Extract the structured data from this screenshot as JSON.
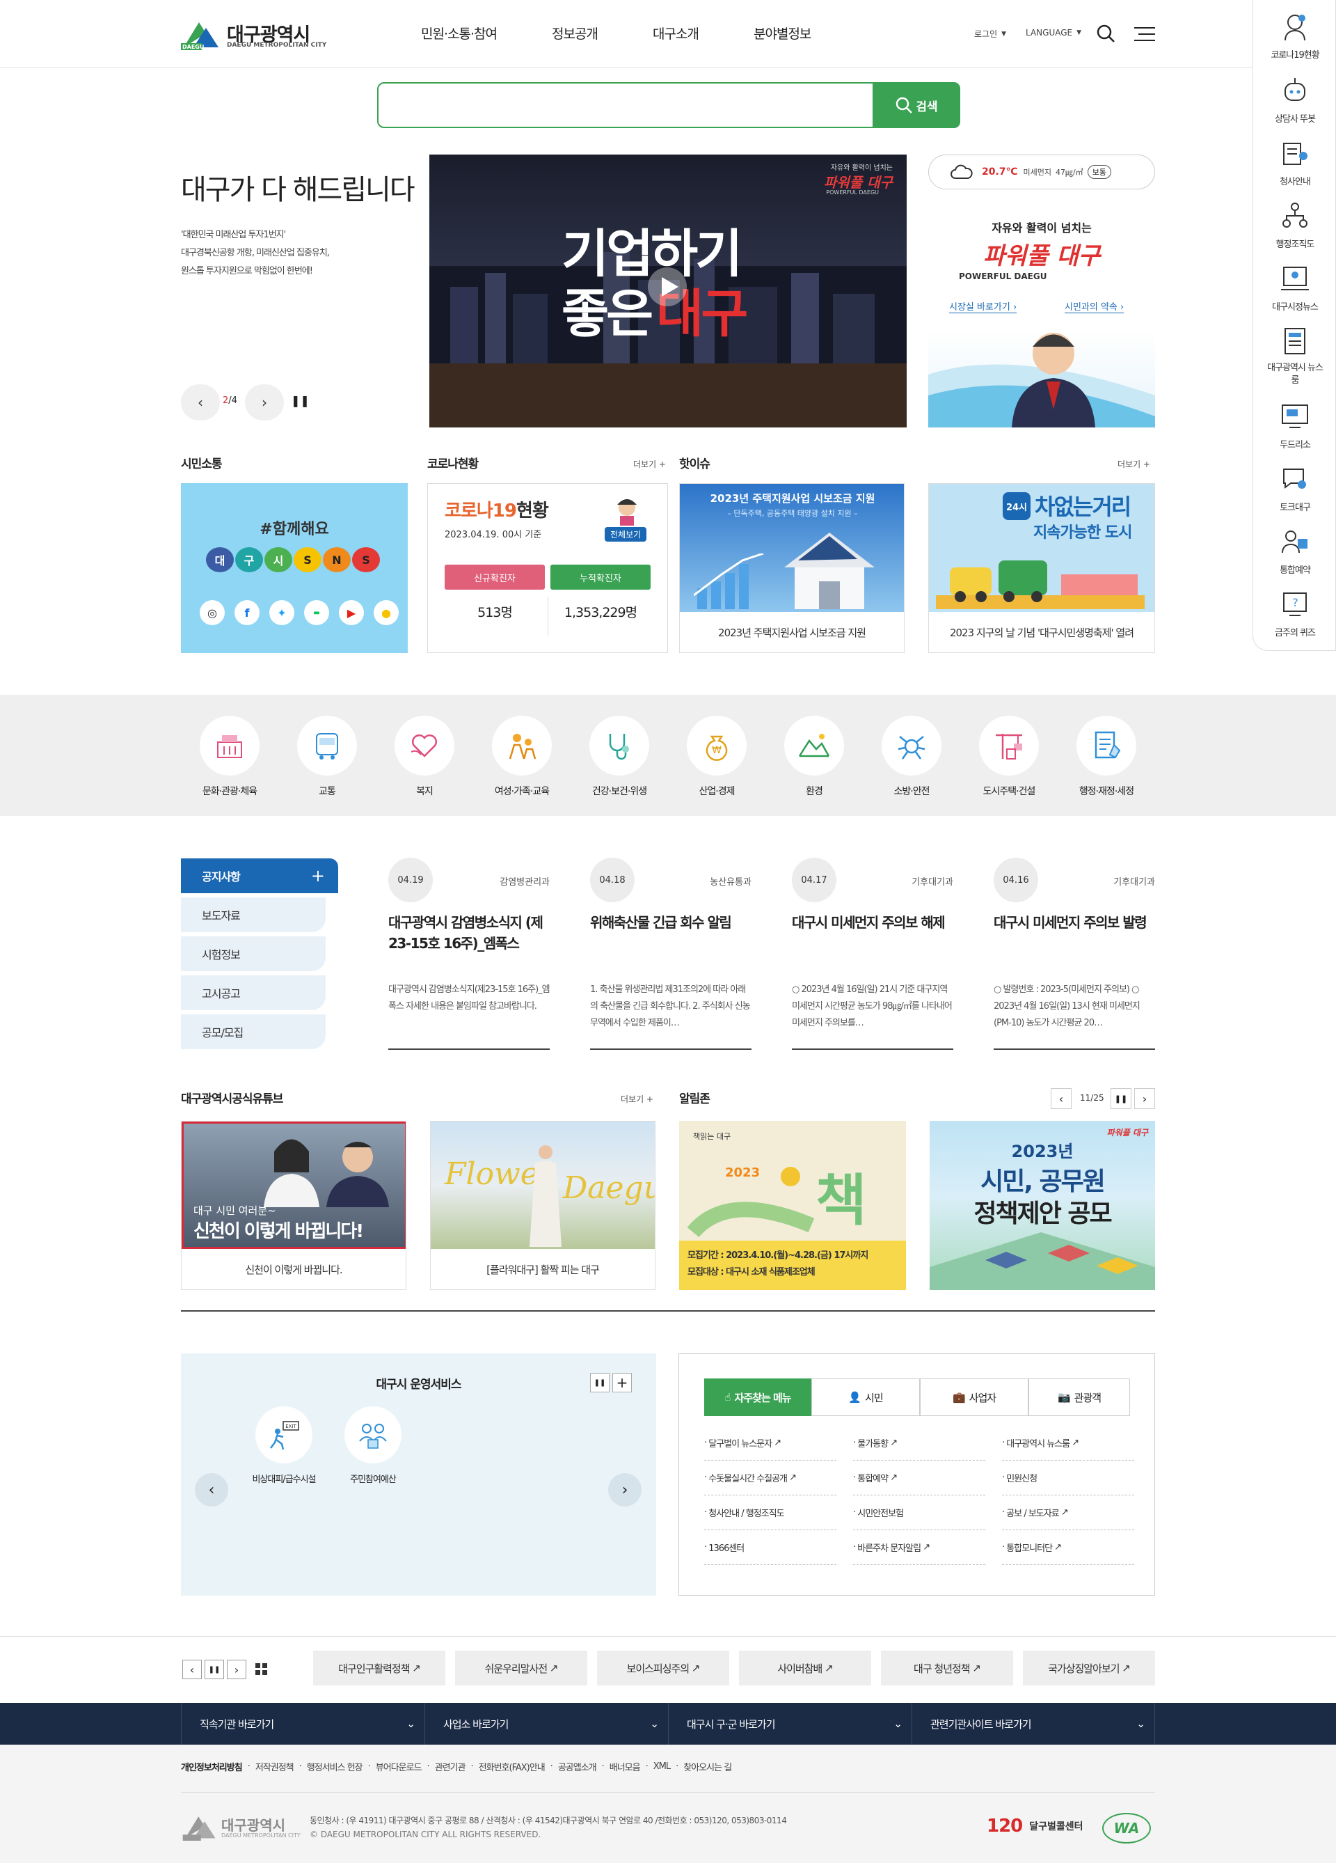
{
  "header": {
    "logo_ko": "대구광역시",
    "logo_en": "DAEGU METROPOLITAN CITY",
    "logo_badge": "DAEGU",
    "nav": [
      "민원·소통·참여",
      "정보공개",
      "대구소개",
      "분야별정보"
    ],
    "login": "로그인",
    "language": "LANGUAGE"
  },
  "quick": [
    {
      "label": "코로나19현황",
      "icon": "virus-person-icon"
    },
    {
      "label": "상담사 뚜봇",
      "icon": "robot-icon"
    },
    {
      "label": "청사안내",
      "icon": "building-icon"
    },
    {
      "label": "행정조직도",
      "icon": "org-chart-icon"
    },
    {
      "label": "대구시정뉴스",
      "icon": "news-person-icon"
    },
    {
      "label": "대구광역시 뉴스룸",
      "icon": "newspaper-icon"
    },
    {
      "label": "두드리소",
      "icon": "monitor-chat-icon"
    },
    {
      "label": "토크대구",
      "icon": "chat-icon"
    },
    {
      "label": "통합예약",
      "icon": "reserve-icon"
    },
    {
      "label": "금주의 퀴즈",
      "icon": "quiz-icon"
    }
  ],
  "search": {
    "placeholder": "",
    "button": "검색"
  },
  "hero": {
    "title": "대구가 다 해드립니다",
    "desc": [
      "'대한민국 미래산업 투자1번지'",
      "대구경북신공항 개항, 미래신산업 집중유치,",
      "원스톱 투자지원으로 막힘없이 한번에!"
    ],
    "page_current": "2",
    "page_total": "/4",
    "video_tag": "자유와 활력이 넘치는",
    "video_brand": "파워풀 대구",
    "video_brand_en": "POWERFUL DAEGU",
    "video_line1": "기업하기",
    "video_line2a": "좋은",
    "video_line2b": "대구"
  },
  "weather": {
    "temp": "20.7℃",
    "dust_label": "미세먼지",
    "dust_value": "47㎍/㎥",
    "status": "보통"
  },
  "mayor": {
    "tag": "자유와 활력이 넘치는",
    "brand": "파워풀 대구",
    "brand_en": "POWERFUL DAEGU",
    "link1": "시장실 바로가기",
    "link2": "시민과의 약속"
  },
  "sections": {
    "sns_title": "시민소통",
    "corona_title": "코로나현황",
    "corona_more": "더보기 +",
    "issue_title": "핫이슈",
    "issue_more": "더보기 +"
  },
  "sns": {
    "hashtag": "#함께해요",
    "letters": [
      "대",
      "구",
      "시",
      "S",
      "N",
      "S"
    ]
  },
  "corona": {
    "title_a": "코로나19",
    "title_b": "현황",
    "date": "2023.04.19. 00시 기준",
    "all": "전체보기",
    "new_label": "신규확진자",
    "cum_label": "누적확진자",
    "new_value": "513명",
    "cum_value": "1,353,229명"
  },
  "issues": [
    {
      "img_title": "2023년 주택지원사업 시보조금 지원",
      "img_sub": "– 단독주택, 공동주택 태양광 설치 지원 –",
      "caption": "2023년 주택지원사업 시보조금 지원"
    },
    {
      "img_badge": "24시",
      "img_title": "차없는거리",
      "img_sub": "지속가능한 도시",
      "caption": "2023 지구의 날 기념 '대구시민생명축제' 열려"
    }
  ],
  "categories": [
    {
      "label": "문화·관광·체육",
      "icon": "culture-icon"
    },
    {
      "label": "교통",
      "icon": "bus-icon"
    },
    {
      "label": "복지",
      "icon": "heart-hands-icon"
    },
    {
      "label": "여성·가족·교육",
      "icon": "family-icon"
    },
    {
      "label": "건강·보건·위생",
      "icon": "stethoscope-icon"
    },
    {
      "label": "산업·경제",
      "icon": "money-bag-icon"
    },
    {
      "label": "환경",
      "icon": "mountain-icon"
    },
    {
      "label": "소방·안전",
      "icon": "bug-icon"
    },
    {
      "label": "도시주택·건설",
      "icon": "crane-icon"
    },
    {
      "label": "행정·재정·세정",
      "icon": "document-icon"
    }
  ],
  "notice_tabs": [
    "공지사항",
    "보도자료",
    "시험정보",
    "고시공고",
    "공모/모집"
  ],
  "notices": [
    {
      "date": "04.19",
      "dept": "감염병관리과",
      "title": "대구광역시 감염병소식지 (제23-15호 16주)_엠폭스",
      "body": "대구광역시 감염병소식지(제23-15호 16주)_엠폭스 자세한 내용은 붙임파일 참고바랍니다."
    },
    {
      "date": "04.18",
      "dept": "농산유통과",
      "title": "위해축산물 긴급 회수 알림",
      "body": "1. 축산물 위생관리법 제31조의2에 따라 아래의 축산물을 긴급 회수합니다. 2. 주식회사 신농무역에서 수입한 제품이…"
    },
    {
      "date": "04.17",
      "dept": "기후대기과",
      "title": "대구시 미세먼지 주의보 해제",
      "body": "○ 2023년 4월 16일(일) 21시 기준 대구지역 미세먼지 시간평균 농도가 98㎍/㎥를 나타내어 미세먼지 주의보를…"
    },
    {
      "date": "04.16",
      "dept": "기후대기과",
      "title": "대구시 미세먼지 주의보 발령",
      "body": "○ 발령번호 : 2023-5(미세먼지 주의보) ○ 2023년 4월 16일(일) 13시 현재 미세먼지(PM-10) 농도가 시간평균 20…"
    }
  ],
  "youtube": {
    "title": "대구광역시공식유튜브",
    "more": "더보기 +",
    "videos": [
      {
        "overlay1": "대구 시민 여러분~",
        "overlay2": "신천이 이렇게 바뀝니다!",
        "caption": "신천이 이렇게 바뀝니다."
      },
      {
        "overlay1": "Flower",
        "overlay2": "Daegu",
        "caption": "[플라워대구] 활짝 피는 대구"
      }
    ]
  },
  "alarm": {
    "title": "알림존",
    "page": "11/25",
    "items": [
      {
        "tag": "책읽는 대구",
        "year": "2023",
        "big": "책",
        "line1": "모집기간 : 2023.4.10.(월)~4.28.(금) 17시까지",
        "line2": "모집대상 : 대구시 소재 식품제조업체"
      },
      {
        "brand": "파워풀 대구",
        "year": "2023년",
        "line1": "시민, 공무원",
        "line2": "정책제안 공모"
      }
    ]
  },
  "ops": {
    "title": "대구시 운영서비스",
    "items": [
      {
        "label": "비상대피/급수시설",
        "icon": "exit-icon"
      },
      {
        "label": "주민참여예산",
        "icon": "people-money-icon"
      }
    ]
  },
  "faq": {
    "tabs": [
      "자주찾는 메뉴",
      "시민",
      "사업자",
      "관광객"
    ],
    "links": [
      [
        "달구벌이 뉴스문자",
        "물가동향",
        "대구광역시 뉴스룸"
      ],
      [
        "수돗물실시간 수질공개",
        "통합예약",
        "민원신청"
      ],
      [
        "청사안내 / 행정조직도",
        "시민안전보험",
        "공보 / 보도자료"
      ],
      [
        "1366센터",
        "바른주차 문자알림",
        "통합모니터단"
      ]
    ]
  },
  "banners": [
    "대구인구활력정책",
    "쉬운우리말사전",
    "보이스피싱주의",
    "사이버참배",
    "대구 청년정책",
    "국가상징알아보기"
  ],
  "dark_selects": [
    "직속기관 바로가기",
    "사업소 바로가기",
    "대구시 구·군 바로가기",
    "관련기관사이트 바로가기"
  ],
  "footer": {
    "links": [
      "개인정보처리방침",
      "저작권정책",
      "행정서비스 헌장",
      "뷰어다운로드",
      "관련기관",
      "전화번호(FAX)안내",
      "공공앱소개",
      "배너모음",
      "XML",
      "찾아오시는 길"
    ],
    "address": "동인청사 : (우 41911) 대구광역시 중구 공평로 88 / 산격청사 : (우 41542)대구광역시 북구 연암로 40 /전화번호 : 053)120, 053)803-0114",
    "copyright": "© DAEGU METROPOLITAN CITY ALL RIGHTS RESERVED.",
    "call_num": "120",
    "call_label": "달구벌콜센터",
    "wa": "WA"
  },
  "colors": {
    "brand_green": "#3aa253",
    "brand_blue": "#1a67b3",
    "navy": "#1b2a45",
    "red": "#d72b2b"
  }
}
